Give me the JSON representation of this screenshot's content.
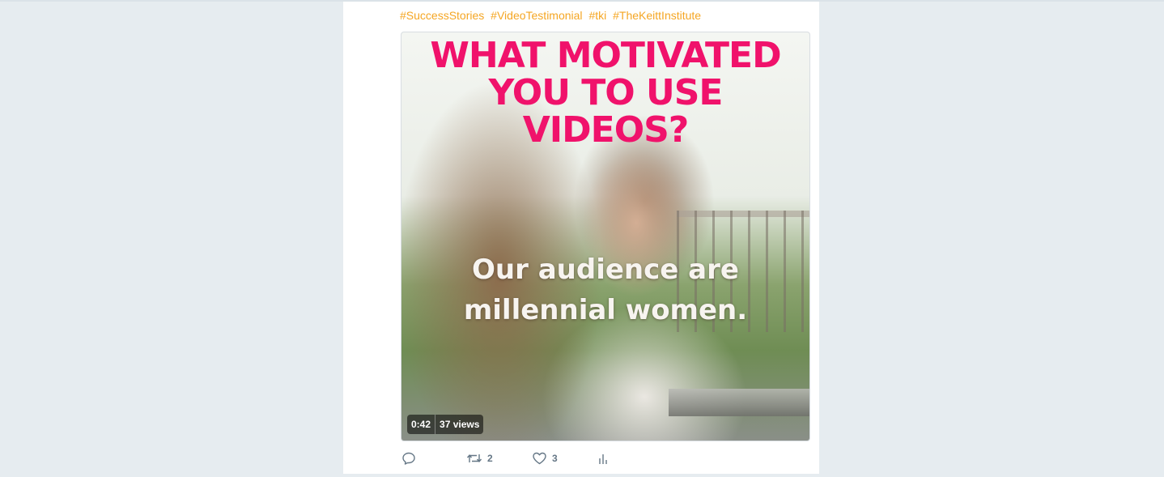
{
  "tweet": {
    "hashtags": [
      "#SuccessStories",
      "#VideoTestimonial",
      "#tki",
      "#TheKeittInstitute"
    ],
    "media": {
      "headline_lines": [
        "WHAT MOTIVATED",
        "YOU TO USE",
        "VIDEOS?"
      ],
      "caption_lines": [
        "Our audience are",
        "millennial women."
      ],
      "duration": "0:42",
      "views": "37 views"
    },
    "actions": {
      "reply_icon": "reply-icon",
      "retweet_icon": "retweet-icon",
      "retweet_count": "2",
      "like_icon": "heart-icon",
      "like_count": "3",
      "analytics_icon": "analytics-icon"
    }
  },
  "colors": {
    "background": "#e6ecf0",
    "hashtag": "#f5a623",
    "headline": "#f0126b",
    "action_gray": "#657786"
  }
}
